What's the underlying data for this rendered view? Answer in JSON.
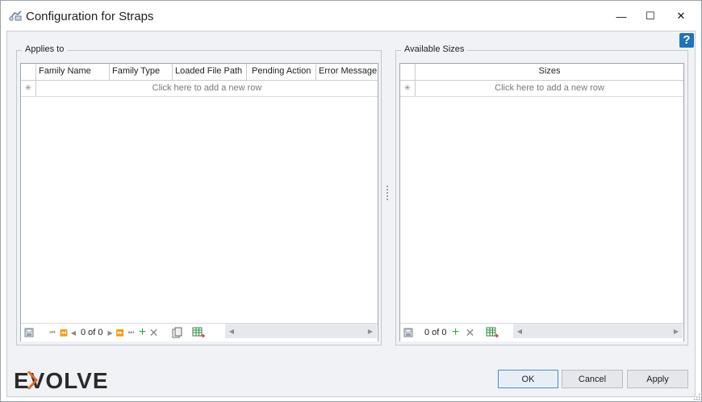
{
  "window": {
    "title": "Configuration for Straps",
    "minimize": "—",
    "maximize": "☐",
    "close": "✕",
    "help": "?"
  },
  "applies_to": {
    "title": "Applies to",
    "columns": [
      "Family Name",
      "Family Type",
      "Loaded File Path",
      "Pending Action",
      "Error Message"
    ],
    "new_row_text": "Click here to add a new row",
    "new_row_marker": "✳",
    "pager": "0 of 0"
  },
  "available_sizes": {
    "title": "Available Sizes",
    "columns": [
      "Sizes"
    ],
    "new_row_text": "Click here to add a new row",
    "new_row_marker": "✳",
    "pager": "0 of 0"
  },
  "footer": {
    "logo": "EVOLVE",
    "logo_accent": "#e06a26",
    "ok": "OK",
    "cancel": "Cancel",
    "apply": "Apply"
  }
}
